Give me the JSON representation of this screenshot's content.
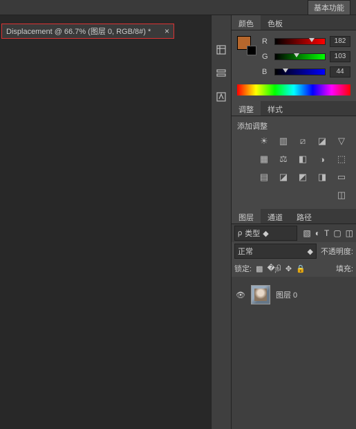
{
  "topbar": {
    "basic_functions": "基本功能"
  },
  "document": {
    "tab_title": "Displacement @ 66.7% (图层 0, RGB/8#) *",
    "close": "×"
  },
  "color_panel": {
    "tabs": {
      "color": "颜色",
      "swatches": "色板"
    },
    "r_label": "R",
    "g_label": "G",
    "b_label": "B",
    "r_value": "182",
    "g_value": "103",
    "b_value": "44",
    "swatch_color": "#b6672c"
  },
  "adjustments_panel": {
    "tabs": {
      "adjustments": "调整",
      "styles": "样式"
    },
    "add_label": "添加调整"
  },
  "layers_panel": {
    "tabs": {
      "layers": "图层",
      "channels": "通道",
      "paths": "路径"
    },
    "kind_label": "类型",
    "blend_mode": "正常",
    "opacity_label": "不透明度:",
    "lock_label": "锁定:",
    "fill_label": "填充:",
    "search_icon": "ρ",
    "layer0_name": "图层 0"
  }
}
